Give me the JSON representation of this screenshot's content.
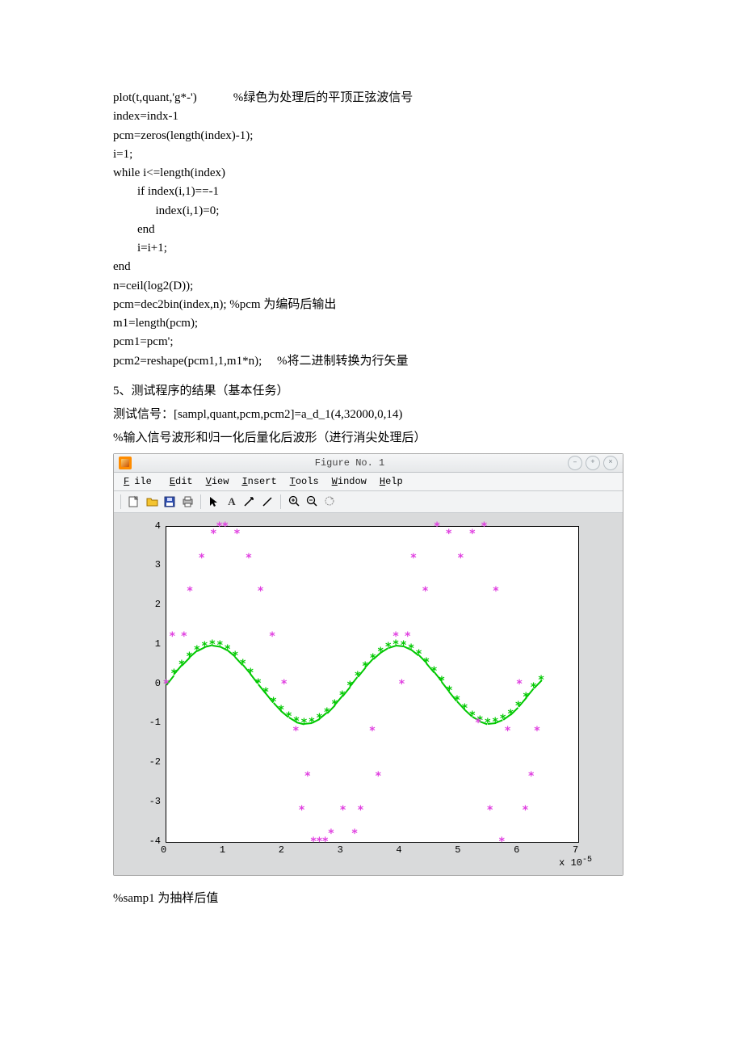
{
  "code": {
    "line1": "plot(t,quant,'g*-')            %绿色为处理后的平顶正弦波信号",
    "line2": "index=indx-1",
    "line3": "pcm=zeros(length(index)-1);",
    "line4": "i=1;",
    "line5": "while i<=length(index)",
    "line6": "        if index(i,1)==-1",
    "line7": "              index(i,1)=0;",
    "line8": "        end",
    "line9": "        i=i+1;",
    "line10": "end",
    "line11": "n=ceil(log2(D));",
    "line12": "pcm=dec2bin(index,n); %pcm 为编码后输出",
    "line13": "m1=length(pcm);",
    "line14": "pcm1=pcm';",
    "line15": "pcm2=reshape(pcm1,1,m1*n);     %将二进制转换为行矢量"
  },
  "section": {
    "head1": "5、测试程序的结果（基本任务）",
    "head2": "测试信号：[sampl,quant,pcm,pcm2]=a_d_1(4,32000,0,14)",
    "head3": "%输入信号波形和归一化后量化后波形（进行消尖处理后）"
  },
  "figure": {
    "title": "Figure No. 1",
    "menus": [
      "File",
      "Edit",
      "View",
      "Insert",
      "Tools",
      "Window",
      "Help"
    ],
    "x_exp": "x 10",
    "x_exp_sup": "-5"
  },
  "chart_data": {
    "type": "scatter",
    "xlim": [
      0,
      7
    ],
    "ylim": [
      -4,
      4
    ],
    "xlabel": "",
    "ylabel": "",
    "xticks": [
      0,
      1,
      2,
      3,
      4,
      5,
      6,
      7
    ],
    "yticks": [
      -4,
      -3,
      -2,
      -1,
      0,
      1,
      2,
      3,
      4
    ],
    "x_unit_exp": -5,
    "series": [
      {
        "name": "quant (green, sine with line)",
        "marker": "*",
        "color": "#00c800",
        "connected": true,
        "x": [
          0.0,
          0.13,
          0.26,
          0.39,
          0.52,
          0.65,
          0.78,
          0.91,
          1.04,
          1.17,
          1.3,
          1.43,
          1.56,
          1.69,
          1.82,
          1.95,
          2.08,
          2.21,
          2.34,
          2.47,
          2.6,
          2.73,
          2.86,
          2.99,
          3.12,
          3.25,
          3.38,
          3.51,
          3.64,
          3.77,
          3.9,
          4.03,
          4.16,
          4.29,
          4.42,
          4.55,
          4.68,
          4.81,
          4.94,
          5.07,
          5.2,
          5.33,
          5.46,
          5.59,
          5.72,
          5.85,
          5.98,
          6.11,
          6.24,
          6.37
        ],
        "y": [
          0.0,
          0.25,
          0.48,
          0.68,
          0.85,
          0.95,
          1.0,
          0.97,
          0.87,
          0.71,
          0.5,
          0.27,
          0.02,
          -0.22,
          -0.46,
          -0.67,
          -0.83,
          -0.95,
          -1.0,
          -0.98,
          -0.88,
          -0.72,
          -0.52,
          -0.29,
          -0.05,
          0.2,
          0.44,
          0.65,
          0.82,
          0.94,
          1.0,
          0.98,
          0.89,
          0.74,
          0.54,
          0.31,
          0.07,
          -0.18,
          -0.42,
          -0.63,
          -0.81,
          -0.93,
          -1.0,
          -0.98,
          -0.9,
          -0.76,
          -0.57,
          -0.34,
          -0.1,
          0.1
        ]
      },
      {
        "name": "samples (magenta, discrete 4x sine)",
        "marker": "*",
        "color": "#e040e0",
        "connected": false,
        "x": [
          0.0,
          0.4,
          0.8,
          1.2,
          1.6,
          2.0,
          2.4,
          2.8,
          3.2,
          3.6,
          4.0,
          4.4,
          4.8,
          5.2,
          5.6,
          6.0,
          0.1,
          0.9,
          2.2,
          2.6,
          3.3,
          4.1,
          5.4,
          5.8
        ],
        "y": [
          0.0,
          2.35,
          3.8,
          3.8,
          2.35,
          0.0,
          -2.35,
          -3.8,
          -3.8,
          -2.35,
          0.0,
          2.35,
          3.8,
          3.8,
          2.35,
          0.0,
          1.2,
          4.0,
          -1.2,
          -4.0,
          -3.2,
          1.2,
          4.0,
          -1.2
        ]
      },
      {
        "name": "extra magenta cluster",
        "marker": "*",
        "color": "#e040e0",
        "connected": false,
        "x": [
          0.3,
          0.6,
          1.0,
          1.4,
          1.8,
          2.3,
          2.5,
          2.7,
          3.0,
          3.5,
          3.9,
          4.2,
          4.6,
          5.0,
          5.3,
          5.5,
          5.7,
          6.1,
          6.2,
          6.3
        ],
        "y": [
          1.2,
          3.2,
          4.0,
          3.2,
          1.2,
          -3.2,
          -4.0,
          -4.0,
          -3.2,
          -1.2,
          1.2,
          3.2,
          4.0,
          3.2,
          -1.0,
          -3.2,
          -4.0,
          -3.2,
          -2.35,
          -1.2
        ]
      }
    ]
  },
  "footer": "%samp1 为抽样后值"
}
